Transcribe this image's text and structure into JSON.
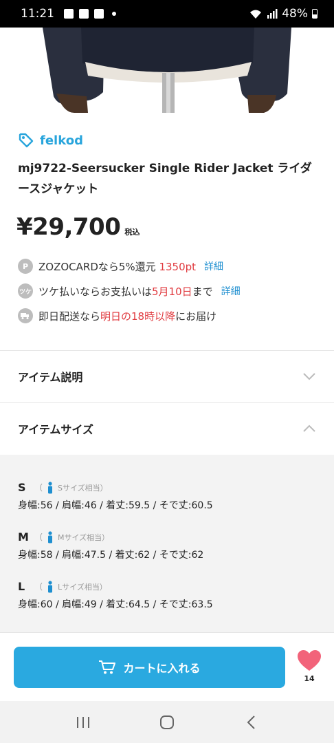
{
  "status_bar": {
    "time": "11:21",
    "battery": "48%"
  },
  "product": {
    "brand": "felkod",
    "title": "mj9722-Seersucker Single Rider Jacket ライダースジャケット",
    "price": "¥29,700",
    "tax_label": "税込"
  },
  "benefits": {
    "zozocard": {
      "icon": "P",
      "prefix": "ZOZOCARDなら5%還元 ",
      "points": "1350pt",
      "link": "詳細"
    },
    "tsuke": {
      "prefix": "ツケ払いならお支払いは",
      "date": "5月10日",
      "suffix": "まで",
      "link": "詳細"
    },
    "delivery": {
      "prefix": "即日配送なら",
      "highlight": "明日の18時以降",
      "suffix": "にお届け"
    }
  },
  "accordions": {
    "description": "アイテム説明",
    "size": "アイテムサイズ"
  },
  "sizes": [
    {
      "name": "S",
      "paren_open": "（",
      "note": "Sサイズ相当）",
      "measurements": "身幅:56 / 肩幅:46 / 着丈:59.5 / そで丈:60.5"
    },
    {
      "name": "M",
      "paren_open": "（",
      "note": "Mサイズ相当）",
      "measurements": "身幅:58 / 肩幅:47.5 / 着丈:62 / そで丈:62"
    },
    {
      "name": "L",
      "paren_open": "（",
      "note": "Lサイズ相当）",
      "measurements": "身幅:60 / 肩幅:49 / 着丈:64.5 / そで丈:63.5"
    }
  ],
  "cart": {
    "label": "カートに入れる"
  },
  "favorite": {
    "count": "14"
  },
  "colors": {
    "accent": "#2aa9e0",
    "highlight": "#e0393e",
    "link": "#1e8fd0",
    "heart": "#f2637a"
  }
}
